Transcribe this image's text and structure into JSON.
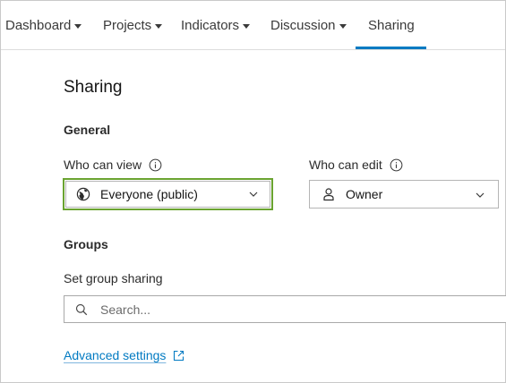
{
  "nav": {
    "items": [
      {
        "label": "Dashboard",
        "has_menu": true
      },
      {
        "label": "Projects",
        "has_menu": true
      },
      {
        "label": "Indicators",
        "has_menu": true
      },
      {
        "label": "Discussion",
        "has_menu": true
      },
      {
        "label": "Sharing",
        "has_menu": false,
        "active": true
      }
    ],
    "active_color": "#007ac2"
  },
  "page": {
    "title": "Sharing"
  },
  "general": {
    "heading": "General",
    "who_can_view": {
      "label": "Who can view",
      "icon": "info-icon",
      "selected": "Everyone (public)",
      "selected_icon": "globe-icon",
      "highlight_color": "#6aa330"
    },
    "who_can_edit": {
      "label": "Who can edit",
      "icon": "info-icon",
      "selected": "Owner",
      "selected_icon": "user-icon"
    }
  },
  "groups": {
    "heading": "Groups",
    "set_group_sharing_label": "Set group sharing",
    "search_placeholder": "Search..."
  },
  "advanced": {
    "link_label": "Advanced settings",
    "icon": "external-link-icon",
    "link_color": "#007ac2"
  }
}
